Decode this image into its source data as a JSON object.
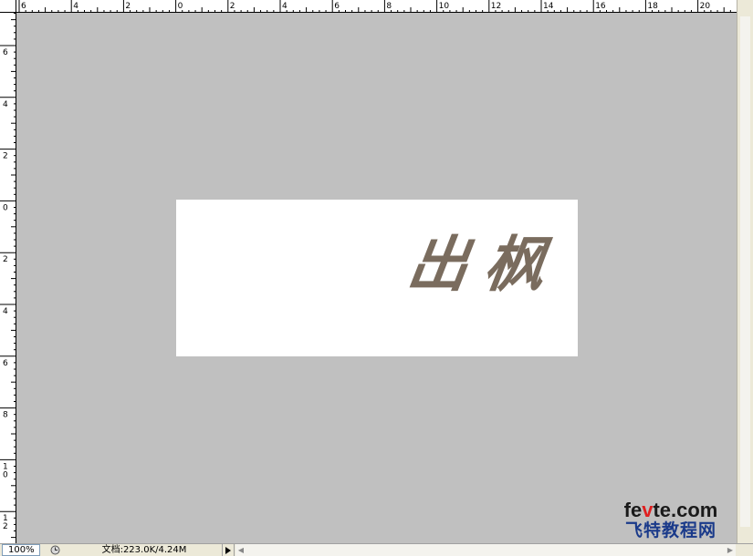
{
  "ruler_top": {
    "labels": [
      "6",
      "4",
      "2",
      "0",
      "2",
      "4",
      "6",
      "8",
      "10",
      "12",
      "14",
      "16",
      "18",
      "20"
    ]
  },
  "ruler_left": {
    "labels": [
      "6",
      "4",
      "2",
      "0",
      "2",
      "4",
      "6",
      "8",
      "10",
      "12"
    ]
  },
  "document": {
    "text": "出枫",
    "text_color": "#7a6c5e",
    "background": "#ffffff"
  },
  "canvas": {
    "background": "#c0c0c0"
  },
  "statusbar": {
    "zoom": "100%",
    "doc_info": "文档:223.0K/4.24M"
  },
  "watermark": {
    "line1_a": "fe",
    "line1_b": "v",
    "line1_c": "te.com",
    "line2": "飞特教程网"
  },
  "icons": {
    "status": "history-icon",
    "menu": "triangle-right-icon",
    "scroll_left": "arrow-left-icon",
    "scroll_right": "arrow-right-icon"
  }
}
